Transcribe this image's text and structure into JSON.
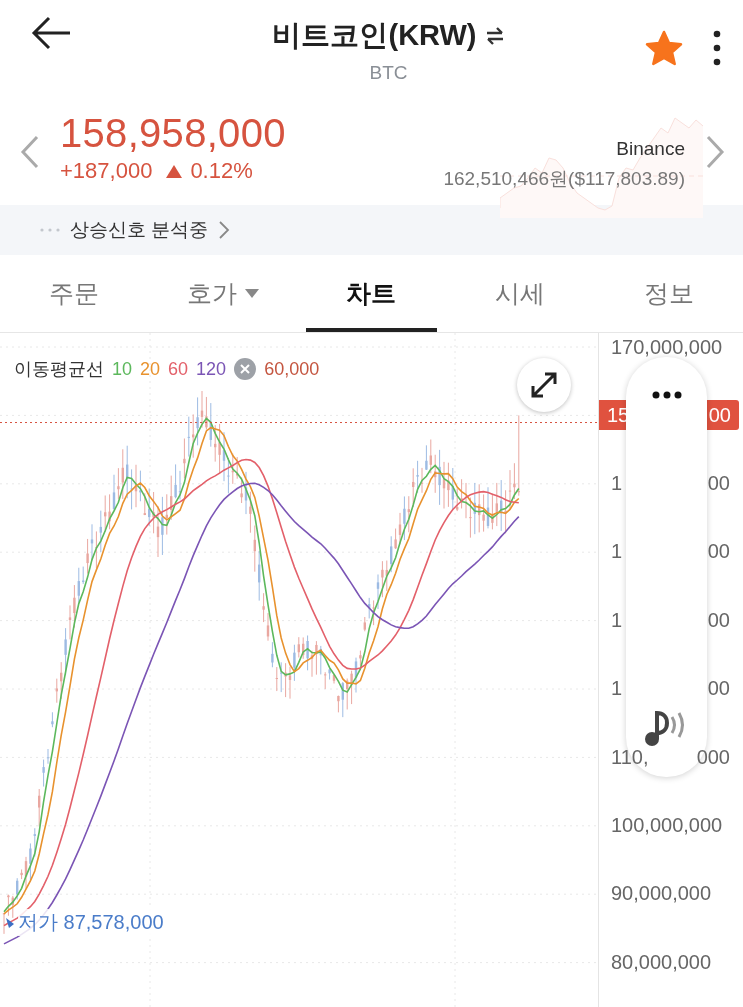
{
  "header": {
    "title": "비트코인(KRW)",
    "subtitle": "BTC",
    "favorite": true
  },
  "price": {
    "current": "158,958,000",
    "change": "+187,000",
    "rising": true,
    "change_rate": "0.12%",
    "exchange": "Binance",
    "exchange_price": "162,510,466원($117,803.89)"
  },
  "signal": {
    "text": "상승신호 분석중"
  },
  "tabs": [
    {
      "label": "주문",
      "selected": false,
      "dropdown": false
    },
    {
      "label": "호가",
      "selected": false,
      "dropdown": true
    },
    {
      "label": "차트",
      "selected": true,
      "dropdown": false
    },
    {
      "label": "시세",
      "selected": false,
      "dropdown": false
    },
    {
      "label": "정보",
      "selected": false,
      "dropdown": false
    }
  ],
  "chart": {
    "legend_title": "이동평균선",
    "moving_averages": [
      {
        "label": "10",
        "color": "#5cb85c"
      },
      {
        "label": "20",
        "color": "#e8922e"
      },
      {
        "label": "60",
        "color": "#e3606a"
      },
      {
        "label": "120",
        "color": "#7b55b5"
      }
    ],
    "high_label": "60,000",
    "low_label": "저가 87,578,000",
    "current_price_tag": {
      "start": "15",
      "end": "00"
    },
    "axis_labels": [
      {
        "start": "170,000,000"
      },
      {
        "start": "1",
        "end": "00"
      },
      {
        "start": "1",
        "end": "00"
      },
      {
        "start": "1",
        "end": "00"
      },
      {
        "start": "1",
        "end": "00"
      },
      {
        "start": "110,",
        "end": "000"
      },
      {
        "start": "100,000,000"
      },
      {
        "start": "90,000,000"
      },
      {
        "start": "80,000,000"
      }
    ]
  }
}
